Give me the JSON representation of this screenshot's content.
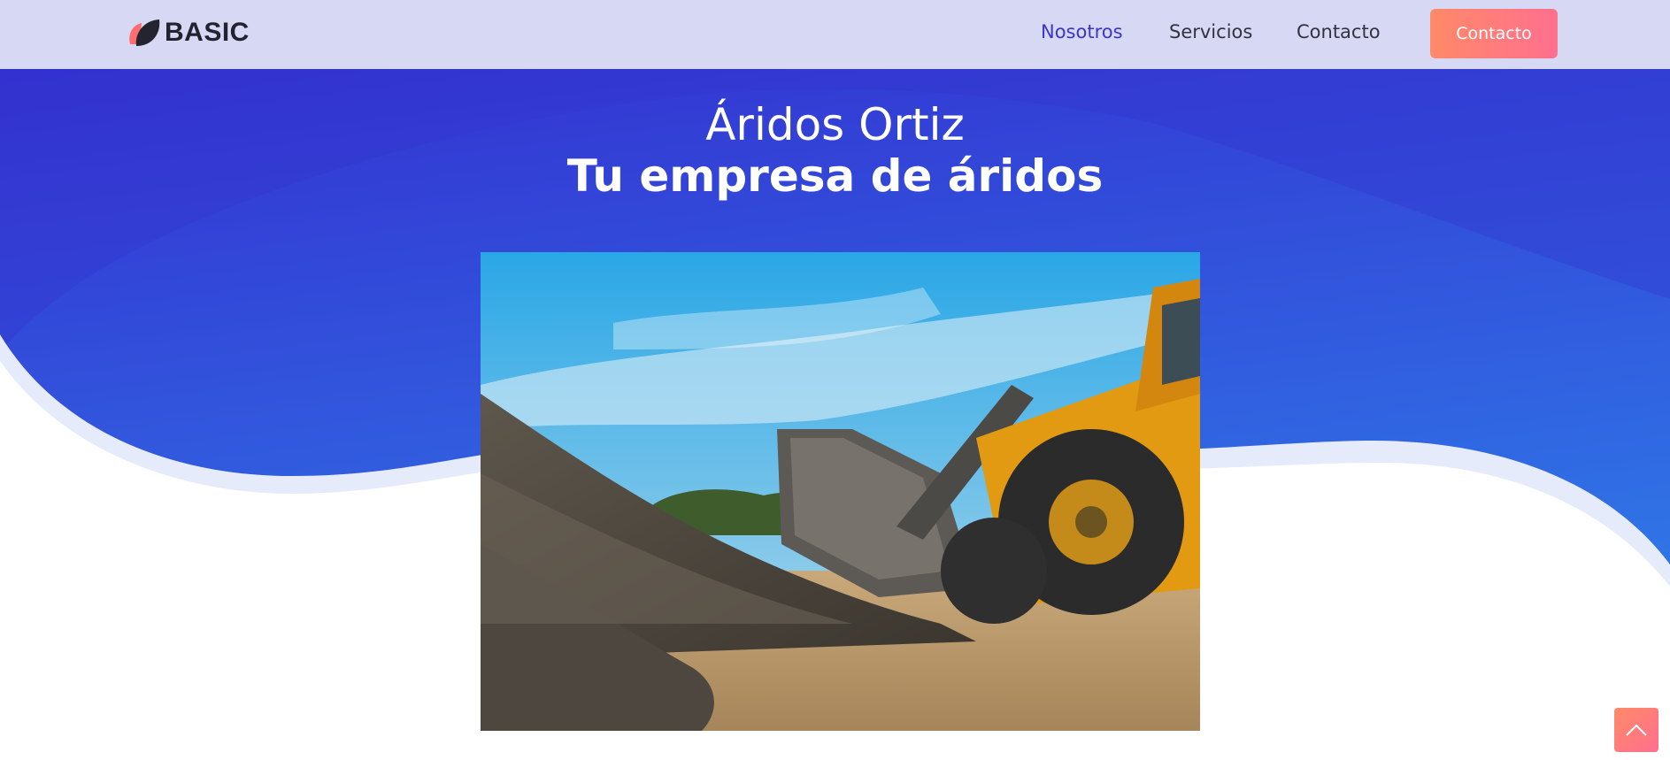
{
  "header": {
    "logo_text": "BASIC",
    "nav": [
      {
        "label": "Nosotros",
        "active": true
      },
      {
        "label": "Servicios",
        "active": false
      },
      {
        "label": "Contacto",
        "active": false
      }
    ],
    "cta_label": "Contacto"
  },
  "hero": {
    "title": "Áridos Ortiz",
    "subtitle": "Tu empresa de áridos"
  },
  "photo": {
    "subject": "front loader and gravel pile"
  },
  "icons": {
    "logo": "leaf-logo-icon",
    "scroll_top": "chevron-up-icon"
  },
  "colors": {
    "header_bg": "#d7d8f3",
    "hero_gradient_top": "#3431d1",
    "hero_gradient_bottom": "#2f7ae8",
    "accent": "#ff7d78",
    "nav_active": "#3d35c9"
  }
}
